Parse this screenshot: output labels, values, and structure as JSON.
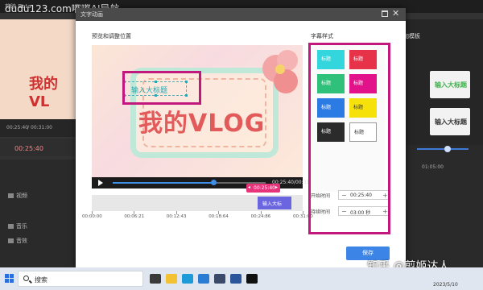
{
  "app": {
    "title": "剪映 Beta",
    "watermark_top": "dudu123.com嘟嘟AI导航"
  },
  "background": {
    "preview_text": "我的VL",
    "left_time": "00:25:40",
    "left_time_total": "00:31:00",
    "right_panel_header": "添加模板",
    "right_add_text": "添加",
    "right_template_labels": [
      "输入大标题",
      "输入大标题"
    ],
    "track_labels": [
      "视频",
      "音乐",
      "音效"
    ],
    "right_ruler_label": "01:05:00"
  },
  "dialog": {
    "title": "文字动画",
    "preview_label": "预览和调整位置",
    "style_label": "字幕样式",
    "subtitle_text": "输入大标题",
    "vlog_text": "我的VLOG",
    "player_time": "00:25:40/00:31:00",
    "progress_percent": 66,
    "playhead_time": "00:25:40",
    "subtitle_clip_label": "输入大标",
    "ruler_labels": [
      "00:00:00",
      "00:06:21",
      "00:12:43",
      "00:18:64",
      "00:24:86",
      "00:31:00"
    ],
    "swatches": [
      {
        "label": "标题",
        "bg": "#33d6dc",
        "fg": "#ffffff"
      },
      {
        "label": "标题",
        "bg": "#e6334a",
        "fg": "#ffffff"
      },
      {
        "label": "标题",
        "bg": "#2fc07a",
        "fg": "#ffffff"
      },
      {
        "label": "标题",
        "bg": "#e2138a",
        "fg": "#ffffff"
      },
      {
        "label": "标题",
        "bg": "#2c7be5",
        "fg": "#ffffff"
      },
      {
        "label": "标题",
        "bg": "#f6e20a",
        "fg": "#333333"
      },
      {
        "label": "标题",
        "bg": "#2b2b2b",
        "fg": "#ffffff"
      },
      {
        "label": "标题",
        "bg": "#ffffff",
        "fg": "#333333"
      }
    ],
    "start_time_label": "开始时间",
    "start_time_value": "00:25:40",
    "duration_label": "持续时间",
    "duration_value": "03:00 秒",
    "save_label": "保存"
  },
  "overlay_watermark": "知乎 @剪姬达人",
  "taskbar": {
    "search_placeholder": "搜索",
    "tray_time": "",
    "tray_date": "2023/5/10"
  },
  "colors": {
    "highlight_magenta": "#c2177d",
    "accent_blue": "#3c85e6",
    "playhead_pink": "#e6337a"
  }
}
